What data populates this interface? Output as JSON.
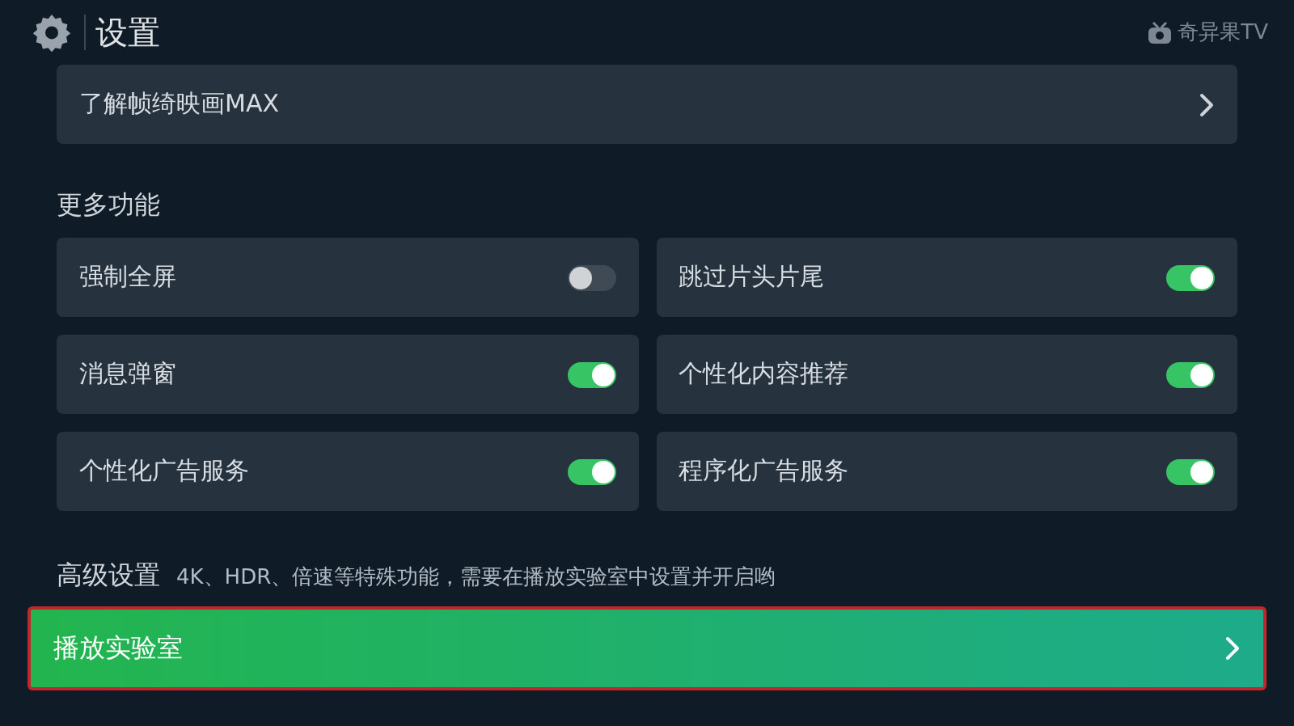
{
  "header": {
    "title": "设置",
    "brand": "奇异果TV"
  },
  "link_row": {
    "label": "了解帧绮映画MAX"
  },
  "more_section": {
    "title": "更多功能",
    "items": [
      {
        "label": "强制全屏",
        "on": false
      },
      {
        "label": "跳过片头片尾",
        "on": true
      },
      {
        "label": "消息弹窗",
        "on": true
      },
      {
        "label": "个性化内容推荐",
        "on": true
      },
      {
        "label": "个性化广告服务",
        "on": true
      },
      {
        "label": "程序化广告服务",
        "on": true
      }
    ]
  },
  "advanced_section": {
    "title": "高级设置",
    "note": "4K、HDR、倍速等特殊功能，需要在播放实验室中设置并开启哟",
    "button": {
      "label": "播放实验室",
      "focused": true
    }
  }
}
